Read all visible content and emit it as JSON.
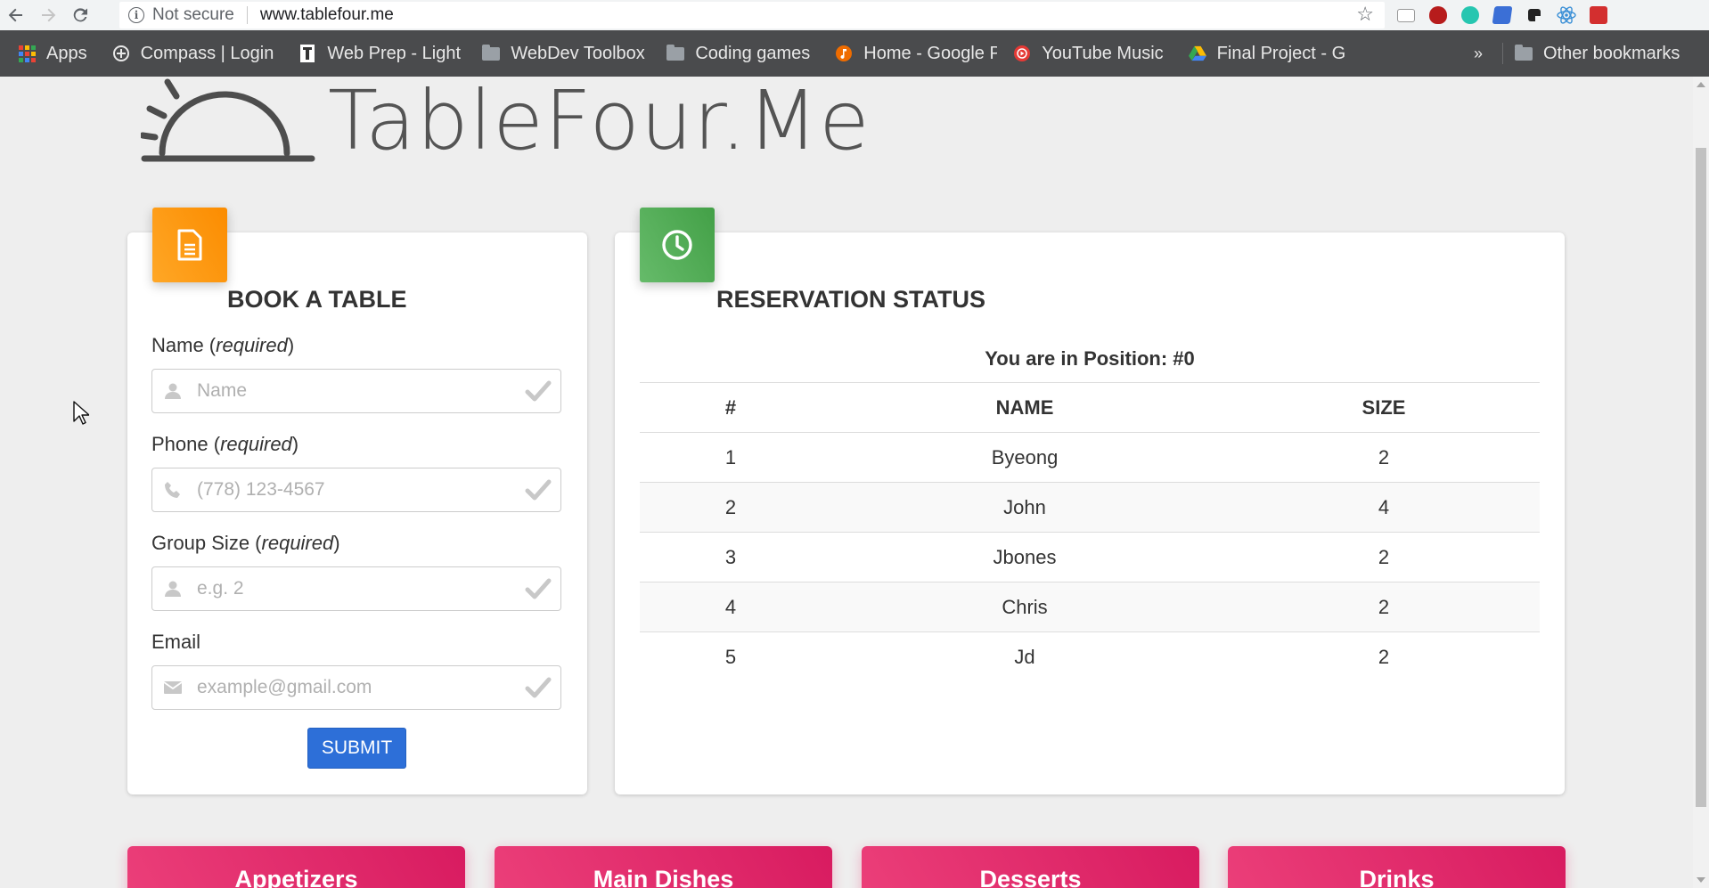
{
  "browser": {
    "security_label": "Not secure",
    "url": "www.tablefour.me",
    "bookmarks": [
      {
        "label": "Apps",
        "icon": "apps-grid-icon"
      },
      {
        "label": "Compass | Login",
        "icon": "compass-icon"
      },
      {
        "label": "Web Prep - Light",
        "icon": "webprep-icon"
      },
      {
        "label": "WebDev Toolbox",
        "icon": "folder-icon"
      },
      {
        "label": "Coding games",
        "icon": "folder-icon"
      },
      {
        "label": "Home - Google P",
        "icon": "google-play-music-icon"
      },
      {
        "label": "YouTube Music",
        "icon": "youtube-music-icon"
      },
      {
        "label": "Final Project - Go",
        "icon": "google-drive-icon"
      }
    ],
    "more_bookmarks": "»",
    "other_bookmarks": "Other bookmarks"
  },
  "page": {
    "logo_text": "TableFour.Me",
    "book": {
      "title": "BOOK A TABLE",
      "name_label": "Name",
      "name_required": "required",
      "name_placeholder": "Name",
      "phone_label": "Phone",
      "phone_required": "required",
      "phone_placeholder": "(778) 123-4567",
      "group_label": "Group Size",
      "group_required": "required",
      "group_placeholder": "e.g. 2",
      "email_label": "Email",
      "email_placeholder": "example@gmail.com",
      "submit_label": "SUBMIT"
    },
    "reservation": {
      "title": "RESERVATION STATUS",
      "position_text": "You are in Position: #0",
      "columns": [
        "#",
        "NAME",
        "SIZE"
      ],
      "rows": [
        {
          "num": "1",
          "name": "Byeong",
          "size": "2"
        },
        {
          "num": "2",
          "name": "John",
          "size": "4"
        },
        {
          "num": "3",
          "name": "Jbones",
          "size": "2"
        },
        {
          "num": "4",
          "name": "Chris",
          "size": "2"
        },
        {
          "num": "5",
          "name": "Jd",
          "size": "2"
        }
      ]
    },
    "menu_tabs": [
      "Appetizers",
      "Main Dishes",
      "Desserts",
      "Drinks"
    ]
  },
  "colors": {
    "book_icon": "#fb8c00",
    "status_icon": "#43a047",
    "submit": "#2d6fd8",
    "menu_tab": "#d81b60"
  }
}
